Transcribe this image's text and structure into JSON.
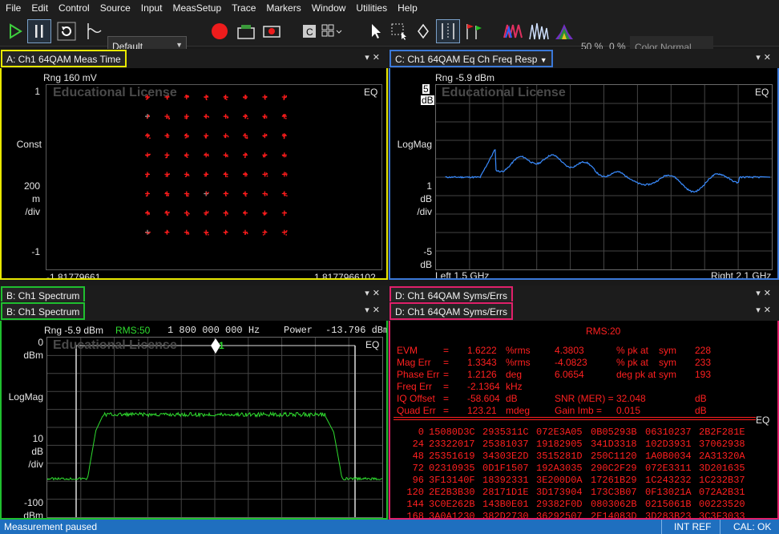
{
  "menu": [
    "File",
    "Edit",
    "Control",
    "Source",
    "Input",
    "MeasSetup",
    "Trace",
    "Markers",
    "Window",
    "Utilities",
    "Help"
  ],
  "toolbar": {
    "preset": "Default",
    "pct1": "50 %",
    "pct2": "0 %",
    "color_mode": "Color Normal"
  },
  "watermark": "Educational License",
  "eq": "EQ",
  "panelA": {
    "title": "A: Ch1 64QAM Meas Time",
    "rng": "Rng 160 mV",
    "y_top": "1",
    "y_fmt": "Const",
    "y_scale": [
      "200",
      "m",
      "/div"
    ],
    "y_bot": "-1",
    "x_left": "-1.81779661",
    "x_right": "1.8177966102"
  },
  "panelC": {
    "title": "C: Ch1 64QAM Eq Ch Freq Resp",
    "rng": "Rng -5.9 dBm",
    "y_top": "5",
    "y_top_unit": "dB",
    "y_fmt": "LogMag",
    "y_scale": [
      "1",
      "dB",
      "/div"
    ],
    "y_bot": "-5",
    "y_bot_unit": "dB",
    "x_left": "Left 1.5 GHz",
    "x_right": "Right 2.1 GHz"
  },
  "panelB": {
    "title": "B: Ch1 Spectrum",
    "title2": "B: Ch1 Spectrum",
    "rng": "Rng -5.9 dBm",
    "rms": "RMS:50",
    "freq": "1 800 000 000 Hz",
    "power_label": "Power",
    "power_value": "-13.796 dBm",
    "y_top": "0",
    "y_top_unit": "dBm",
    "y_fmt": "LogMag",
    "y_scale": [
      "10",
      "dB",
      "/div"
    ],
    "y_bot": "-100",
    "y_bot_unit": "dBm",
    "marker": "1"
  },
  "panelD": {
    "title": "D: Ch1 64QAM Syms/Errs",
    "title2": "D: Ch1 64QAM Syms/Errs",
    "rms": "RMS:20",
    "errors": [
      [
        "EVM",
        "=",
        "1.6222",
        "%rms",
        "4.3803",
        "% pk  at",
        "sym",
        "228"
      ],
      [
        "Mag Err",
        "=",
        "1.3343",
        "%rms",
        "-4.0823",
        "% pk  at",
        "sym",
        "233"
      ],
      [
        "Phase Err",
        "=",
        "1.2126",
        "deg",
        "6.0654",
        "deg  pk  at",
        "sym",
        "193"
      ],
      [
        "Freq Err",
        "=",
        "-2.1364",
        "kHz",
        "",
        "",
        "",
        ""
      ],
      [
        "IQ Offset",
        "=",
        "-58.604",
        "dB",
        "SNR (MER)  =",
        "32.048",
        "",
        "dB"
      ],
      [
        "Quad Err",
        "=",
        "123.21",
        "mdeg",
        "Gain  Imb    =",
        "0.015",
        "",
        "dB"
      ]
    ],
    "symbols": [
      [
        "0",
        "15080D3C",
        "2935311C",
        "072E3A05",
        "0B05293B",
        "06310237",
        "2B2F281E"
      ],
      [
        "24",
        "23322017",
        "25381037",
        "19182905",
        "341D3318",
        "102D3931",
        "37062938"
      ],
      [
        "48",
        "25351619",
        "34303E2D",
        "3515281D",
        "250C1120",
        "1A0B0034",
        "2A31320A"
      ],
      [
        "72",
        "02310935",
        "0D1F1507",
        "192A3035",
        "290C2F29",
        "072E3311",
        "3D201635"
      ],
      [
        "96",
        "3F13140F",
        "18392331",
        "3E200D0A",
        "17261B29",
        "1C243232",
        "1C232B37"
      ],
      [
        "120",
        "2E2B3B30",
        "28171D1E",
        "3D173904",
        "173C3B07",
        "0F13021A",
        "072A2B31"
      ],
      [
        "144",
        "3C0E262B",
        "143B0E01",
        "29382F0D",
        "0803062B",
        "0215061B",
        "00223520"
      ],
      [
        "168",
        "3A0A1230",
        "382D2730",
        "36292507",
        "2E14083D",
        "3D283B23",
        "3C3F3033"
      ]
    ]
  },
  "status": {
    "left": "Measurement paused",
    "int_ref": "INT REF",
    "cal": "CAL: OK"
  },
  "colors": {
    "yellow": "#e8e800",
    "blue": "#3a78d8",
    "green": "#1fbf2f",
    "red": "#ff2020",
    "pink": "#e0206a"
  }
}
